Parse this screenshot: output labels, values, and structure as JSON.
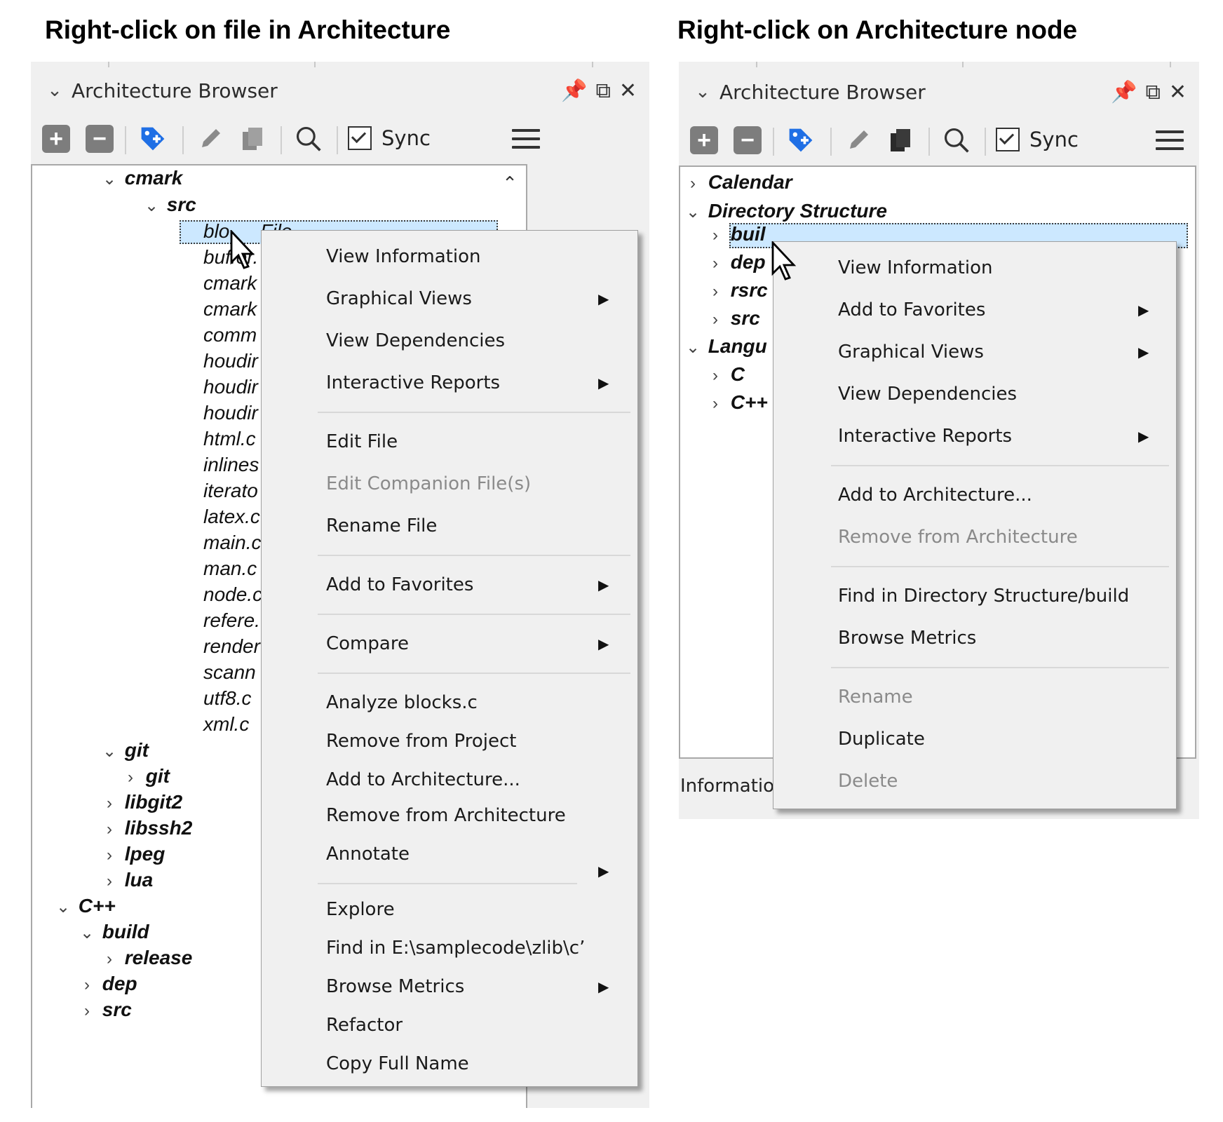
{
  "headings": {
    "left": "Right-click on file in Architecture",
    "right": "Right-click on Architecture node"
  },
  "browser": {
    "title": "Architecture Browser",
    "sync_label": "Sync",
    "title_controls": [
      "pin-icon",
      "float-icon",
      "close-icon"
    ],
    "toolbar_icons": [
      "expand-all-icon",
      "collapse-all-icon",
      "tag-icon",
      "edit-icon",
      "copy-icon",
      "search-icon",
      "menu-icon"
    ]
  },
  "left_tree": {
    "cmark": "cmark",
    "src": "src",
    "files": [
      "blocks.c",
      "buffer.c",
      "cmark.c",
      "cmark_ctype.c",
      "commonmark.c",
      "houdini_href_e.c",
      "houdini_html_e.c",
      "houdini_html_u.c",
      "html.c",
      "inlines.c",
      "iterator.c",
      "latex.c",
      "main.c",
      "man.c",
      "node.c",
      "references.c",
      "render.c",
      "scanners.c",
      "utf8.c",
      "xml.c"
    ],
    "files_visible": [
      "blo",
      "buffer.",
      "cmark",
      "cmark",
      "comm",
      "houdir",
      "houdir",
      "houdir",
      "html.c",
      "inlines",
      "iterato",
      "latex.c",
      "main.c",
      "man.c",
      "node.c",
      "refere.",
      "render",
      "scann",
      "utf8.c",
      "xml.c"
    ],
    "selected_file_suffix": "File",
    "git": "git",
    "git_child": "git",
    "libgit2": "libgit2",
    "libssh2": "libssh2",
    "lpeg": "lpeg",
    "lua": "lua",
    "cpp": "C++",
    "build": "build",
    "release": "release",
    "dep": "dep",
    "src2": "src"
  },
  "left_menu": {
    "view_information": "View Information",
    "graphical_views": "Graphical Views",
    "view_dependencies": "View Dependencies",
    "interactive_reports": "Interactive Reports",
    "edit_file": "Edit File",
    "edit_companion": "Edit Companion File(s)",
    "rename_file": "Rename File",
    "add_to_favorites": "Add to Favorites",
    "compare": "Compare",
    "analyze": "Analyze blocks.c",
    "remove_from_project": "Remove from Project",
    "add_to_architecture": "Add to Architecture...",
    "remove_from_architecture": "Remove from Architecture",
    "annotate": "Annotate",
    "explore": "Explore",
    "find_in": "Find in E:\\samplecode\\zlib\\c’",
    "browse_metrics": "Browse Metrics",
    "refactor": "Refactor",
    "copy_full_name": "Copy Full Name"
  },
  "right_tree": {
    "calendar": "Calendar",
    "directory_structure": "Directory Structure",
    "build": "build",
    "build_visible": "buil",
    "dep": "dep",
    "rsrc": "rsrc",
    "src": "src",
    "languages": "Langu",
    "c": "C",
    "cpp": "C++"
  },
  "right_menu": {
    "view_information": "View Information",
    "add_to_favorites": "Add to Favorites",
    "graphical_views": "Graphical Views",
    "view_dependencies": "View Dependencies",
    "interactive_reports": "Interactive Reports",
    "add_to_architecture": "Add to Architecture...",
    "remove_from_architecture": "Remove from Architecture",
    "find_in": "Find in Directory Structure/build",
    "browse_metrics": "Browse Metrics",
    "rename": "Rename",
    "duplicate": "Duplicate",
    "delete": "Delete"
  },
  "right_status": "Informatio",
  "colors": {
    "selection": "#cce8ff",
    "panel_bg": "#f0f0f0",
    "tag_icon": "#1f6fe5",
    "disabled_text": "#8a8a8a"
  }
}
